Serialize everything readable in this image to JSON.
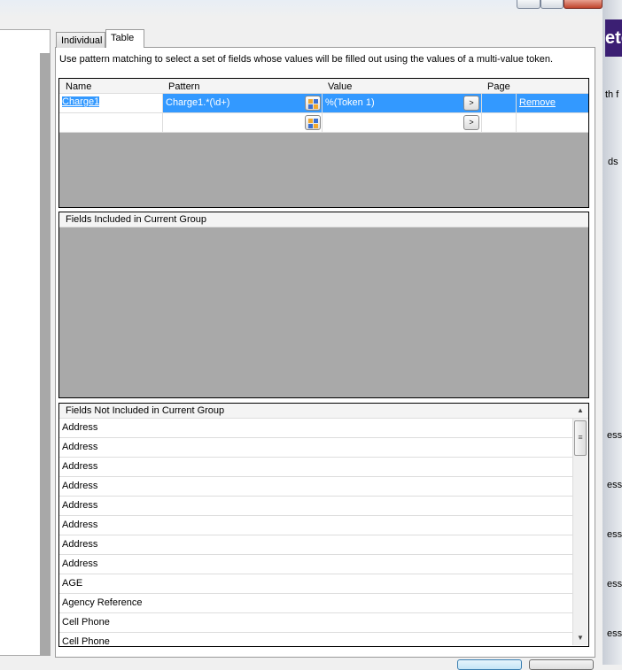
{
  "tabs": [
    {
      "label": "Individual"
    },
    {
      "label": "Table"
    }
  ],
  "description": "Use pattern matching to select a set of fields whose values will be filled out using the values of a multi-value token.",
  "pattern_grid": {
    "columns": [
      "Name",
      "Pattern",
      "Value",
      "Page",
      ""
    ],
    "rows": [
      {
        "name": "Charge1",
        "pattern": "Charge1.*(\\d+)",
        "value": "%(Token 1)",
        "page": "",
        "action": "Remove",
        "selected": true
      },
      {
        "name": "",
        "pattern": "",
        "value": "",
        "page": "",
        "action": ""
      }
    ],
    "value_button_label": ">"
  },
  "included": {
    "title": "Fields Included in Current Group"
  },
  "not_included": {
    "title": "Fields Not Included in Current Group",
    "items": [
      "Address",
      "Address",
      "Address",
      "Address",
      "Address",
      "Address",
      "Address",
      "Address",
      "AGE",
      "Agency Reference",
      "Cell Phone",
      "Cell Phone"
    ]
  },
  "right_strip": {
    "heading": "ete",
    "snippets": [
      "th f",
      "ds",
      "ess'",
      "ess'",
      "ess'",
      "ess'",
      "ess'"
    ]
  },
  "colors": {
    "selection": "#3399ff",
    "gray": "#a9a9a9",
    "purple": "#3b1f73"
  }
}
